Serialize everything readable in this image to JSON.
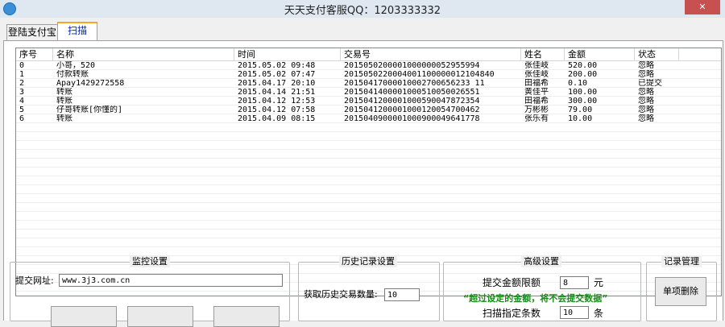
{
  "window": {
    "title": "天天支付客服QQ：1203333332",
    "close_glyph": "✕"
  },
  "tabs": [
    {
      "label": "登陆支付宝",
      "active": false
    },
    {
      "label": "扫描",
      "active": true
    }
  ],
  "table": {
    "columns": [
      "序号",
      "名称",
      "时间",
      "交易号",
      "姓名",
      "金额",
      "状态"
    ],
    "rows": [
      [
        "0",
        "小哥，520",
        "2015.05.02 09:48",
        "2015050200001000000052955994",
        "张佳岐",
        "520.00",
        "忽略"
      ],
      [
        "1",
        "付款转账",
        "2015.05.02 07:47",
        "2015050220004001100000012104840",
        "张佳岐",
        "200.00",
        "忽略"
      ],
      [
        "2",
        "Apay1429272558",
        "2015.04.17 20:10",
        "20150417000010002700656233 11",
        "田福希",
        "0.10",
        "已提交"
      ],
      [
        "3",
        "转账",
        "2015.04.14 21:51",
        "2015041400001000510050026551",
        "黄佳平",
        "100.00",
        "忽略"
      ],
      [
        "4",
        "转账",
        "2015.04.12 12:53",
        "2015041200001000590047872354",
        "田福希",
        "300.00",
        "忽略"
      ],
      [
        "5",
        "仔哥转账[你懂的]",
        "2015.04.12 07:58",
        "2015041200001000120054700462",
        "万彬彬",
        "79.00",
        "忽略"
      ],
      [
        "6",
        "转账",
        "2015.04.09 08:15",
        "2015040900001000900049641778",
        "张乐有",
        "10.00",
        "忽略"
      ]
    ]
  },
  "monitor": {
    "title": "监控设置",
    "url_label": "提交网址:",
    "url_value": "www.3j3.com.cn"
  },
  "history": {
    "title": "历史记录设置",
    "count_label": "获取历史交易数量:",
    "count_value": "10"
  },
  "advanced": {
    "title": "高级设置",
    "limit_label": "提交金额限额",
    "limit_value": "8",
    "limit_unit": "元",
    "note": "“超过设定的金额，将不会提交数据”",
    "scan_label": "扫描指定条数",
    "scan_value": "10",
    "scan_unit": "条"
  },
  "records": {
    "title": "记录管理",
    "delete_label": "单项删除"
  }
}
